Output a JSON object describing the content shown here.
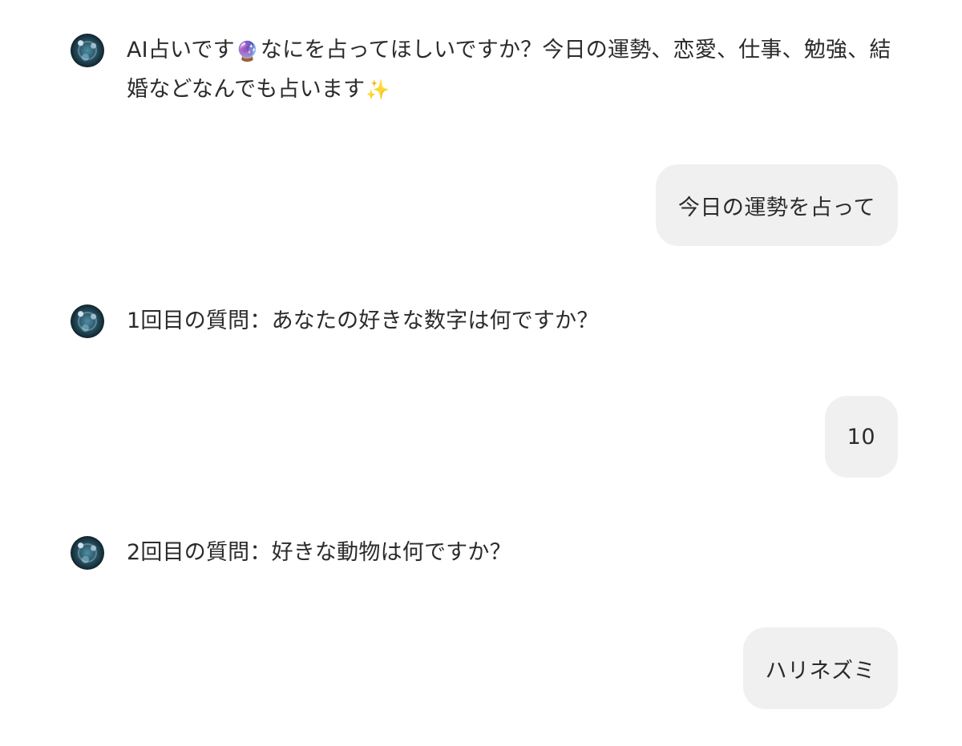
{
  "messages": {
    "bot_1": {
      "text_a": "AI占いです",
      "emoji_a": "🔮",
      "text_b": "なにを占ってほしいですか？今日の運勢、恋愛、仕事、勉強、結婚などなんでも占います",
      "emoji_b": "✨"
    },
    "user_1": "今日の運勢を占って",
    "bot_2": "1回目の質問：あなたの好きな数字は何ですか？",
    "user_2": "10",
    "bot_3": "2回目の質問：好きな動物は何ですか？",
    "user_3": "ハリネズミ"
  },
  "avatar": {
    "icon": "crystal-ball-avatar-icon",
    "colors": [
      "#4e8da4",
      "#122a33"
    ]
  },
  "colors": {
    "background": "#ffffff",
    "user_bubble": "#f0f0f0",
    "text": "#2b2b2b"
  }
}
